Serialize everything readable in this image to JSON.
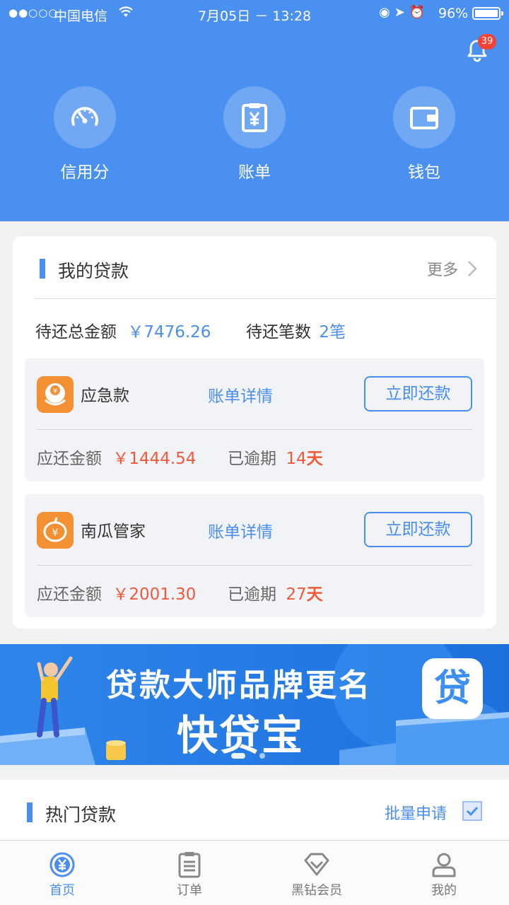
{
  "status_bar": {
    "signal": "●●○○○",
    "carrier": "中国电信",
    "time": "7月05日 － 13:28",
    "battery": "96%"
  },
  "header": {
    "notification_count": "39",
    "quick_actions": [
      {
        "label": "信用分",
        "icon": "speedometer-icon"
      },
      {
        "label": "账单",
        "icon": "bill-icon"
      },
      {
        "label": "钱包",
        "icon": "wallet-icon"
      }
    ]
  },
  "my_loans": {
    "title": "我的贷款",
    "more_label": "更多",
    "total_label": "待还总金额",
    "total_value": "￥7476.26",
    "count_label": "待还笔数",
    "count_value": "2笔",
    "items": [
      {
        "name": "应急款",
        "detail_label": "账单详情",
        "repay_label": "立即还款",
        "due_label": "应还金额",
        "due_value": "￥1444.54",
        "overdue_label": "已逾期",
        "overdue_days": "14",
        "overdue_unit": "天"
      },
      {
        "name": "南瓜管家",
        "detail_label": "账单详情",
        "repay_label": "立即还款",
        "due_label": "应还金额",
        "due_value": "￥2001.30",
        "overdue_label": "已逾期",
        "overdue_days": "27",
        "overdue_unit": "天"
      }
    ]
  },
  "banner": {
    "line1": "贷款大师品牌更名",
    "line2": "快贷宝",
    "logo_char": "贷"
  },
  "hot_loans": {
    "title": "热门贷款",
    "batch_label": "批量申请"
  },
  "tab_bar": [
    {
      "label": "首页",
      "icon": "home-yen-icon",
      "active": true
    },
    {
      "label": "订单",
      "icon": "clipboard-icon",
      "active": false
    },
    {
      "label": "黑钻会员",
      "icon": "diamond-icon",
      "active": false
    },
    {
      "label": "我的",
      "icon": "person-icon",
      "active": false
    }
  ],
  "colors": {
    "primary": "#4a90f0",
    "accent_blue": "#4a8ef0",
    "alert_red": "#f0593a",
    "badge_red": "#f44336"
  }
}
